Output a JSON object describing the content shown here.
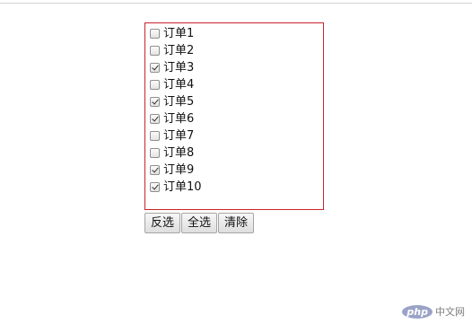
{
  "orders": [
    {
      "label": "订单1",
      "checked": false
    },
    {
      "label": "订单2",
      "checked": false
    },
    {
      "label": "订单3",
      "checked": true
    },
    {
      "label": "订单4",
      "checked": false
    },
    {
      "label": "订单5",
      "checked": true
    },
    {
      "label": "订单6",
      "checked": true
    },
    {
      "label": "订单7",
      "checked": false
    },
    {
      "label": "订单8",
      "checked": false
    },
    {
      "label": "订单9",
      "checked": true
    },
    {
      "label": "订单10",
      "checked": true
    }
  ],
  "buttons": {
    "invert": "反选",
    "select_all": "全选",
    "clear": "清除"
  },
  "watermark": {
    "logo": "php",
    "text": "中文网"
  },
  "colors": {
    "box_border": "#c8232c",
    "logo_bg": "#8993be"
  }
}
